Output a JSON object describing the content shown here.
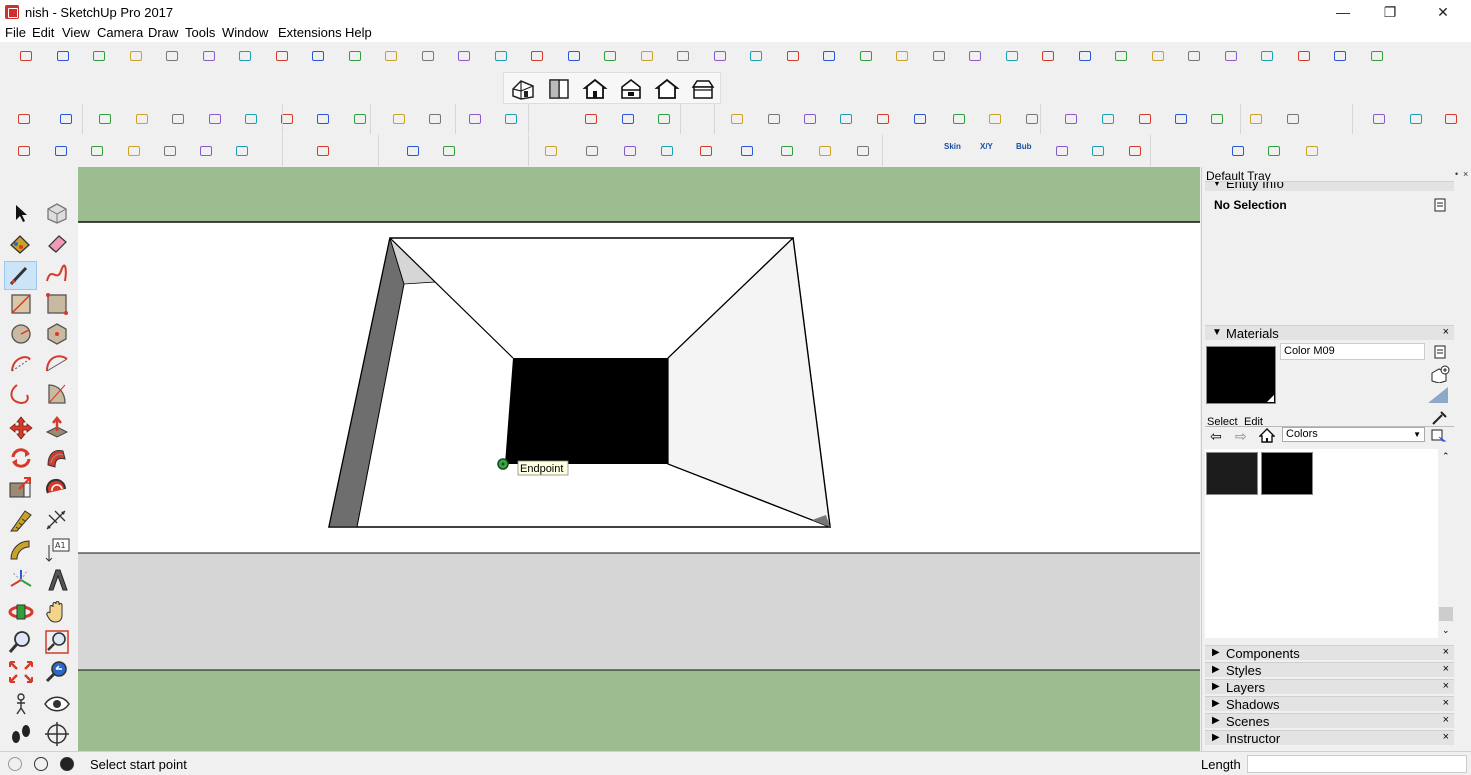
{
  "window": {
    "title": "nish - SketchUp Pro 2017",
    "minimize_glyph": "—",
    "maximize_glyph": "❐",
    "close_glyph": "✕"
  },
  "menu": [
    "File",
    "Edit",
    "View",
    "Camera",
    "Draw",
    "Tools",
    "Window",
    "Extensions",
    "Help"
  ],
  "toolbar": {
    "row4_labels": [
      "Skin",
      "X/Y",
      "Bub"
    ]
  },
  "viewport": {
    "inference_tooltip": "Endpoint",
    "sky_color": "#9cbd90",
    "ground_color": "#d6d6d6",
    "background_color": "#ffffff",
    "face_color": "#000000"
  },
  "tray": {
    "title": "Default Tray",
    "pin_glyph": "•",
    "close_glyph": "×",
    "entity_info": {
      "header": "Entity Info",
      "selection": "No Selection"
    },
    "materials": {
      "header": "Materials",
      "material_name": "Color M09",
      "preview_color": "#000000",
      "tab_select": "Select",
      "tab_edit": "Edit",
      "library": "Colors",
      "swatches": [
        "#1c1c1c",
        "#000000"
      ]
    },
    "panels": [
      "Components",
      "Styles",
      "Layers",
      "Shadows",
      "Scenes",
      "Instructor"
    ]
  },
  "status": {
    "prompt": "Select start point",
    "measurements_label": "Length",
    "measurements_value": ""
  }
}
